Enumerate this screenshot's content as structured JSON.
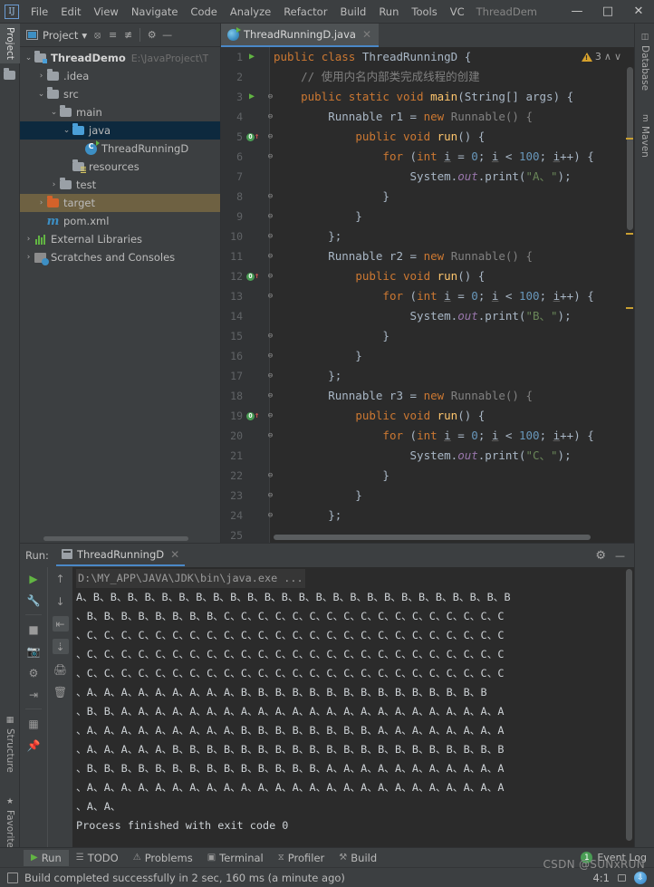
{
  "window": {
    "logo": "IJ",
    "project_name": "ThreadDem",
    "menus": [
      "File",
      "Edit",
      "View",
      "Navigate",
      "Code",
      "Analyze",
      "Refactor",
      "Build",
      "Run",
      "Tools",
      "VC"
    ],
    "minimize": "—",
    "maximize": "□",
    "close": "✕"
  },
  "left_strip": [
    {
      "label": "Project",
      "icon": "folder-icon",
      "active": true
    },
    {
      "label": "Structure",
      "icon": "structure-icon",
      "active": false
    },
    {
      "label": "Favorites",
      "icon": "star-icon",
      "active": false
    }
  ],
  "right_strip": [
    {
      "label": "Database",
      "icon": "database-icon"
    },
    {
      "label": "Maven",
      "icon": "maven-icon"
    }
  ],
  "project_panel": {
    "title": "Project",
    "dropdown_caret": "▾",
    "toolbar_icons": [
      "locate-icon",
      "expand-all-icon",
      "collapse-all-icon",
      "settings-gear-icon",
      "hide-icon"
    ],
    "tree": [
      {
        "label": "ThreadDemo",
        "path": "E:\\JavaProject\\T",
        "arrow": "⌄",
        "icon": "module-folder-icon",
        "indent": 0,
        "bold": true,
        "state": "normal"
      },
      {
        "label": ".idea",
        "path": "",
        "arrow": "›",
        "icon": "folder-icon",
        "indent": 1,
        "bold": false,
        "state": "normal"
      },
      {
        "label": "src",
        "path": "",
        "arrow": "⌄",
        "icon": "folder-icon",
        "indent": 1,
        "bold": false,
        "state": "normal"
      },
      {
        "label": "main",
        "path": "",
        "arrow": "⌄",
        "icon": "folder-icon",
        "indent": 2,
        "bold": false,
        "state": "normal"
      },
      {
        "label": "java",
        "path": "",
        "arrow": "⌄",
        "icon": "source-folder-icon",
        "indent": 3,
        "bold": false,
        "state": "selected"
      },
      {
        "label": "ThreadRunningD",
        "path": "",
        "arrow": "",
        "icon": "java-class-icon",
        "indent": 4,
        "bold": false,
        "state": "normal"
      },
      {
        "label": "resources",
        "path": "",
        "arrow": "",
        "icon": "resources-folder-icon",
        "indent": 3,
        "bold": false,
        "state": "normal"
      },
      {
        "label": "test",
        "path": "",
        "arrow": "›",
        "icon": "folder-icon",
        "indent": 2,
        "bold": false,
        "state": "normal"
      },
      {
        "label": "target",
        "path": "",
        "arrow": "›",
        "icon": "target-folder-icon",
        "indent": 1,
        "bold": false,
        "state": "highlighted"
      },
      {
        "label": "pom.xml",
        "path": "",
        "arrow": "",
        "icon": "maven-pom-icon",
        "indent": 1,
        "bold": false,
        "state": "normal"
      },
      {
        "label": "External Libraries",
        "path": "",
        "arrow": "›",
        "icon": "libraries-icon",
        "indent": 0,
        "bold": false,
        "state": "normal"
      },
      {
        "label": "Scratches and Consoles",
        "path": "",
        "arrow": "›",
        "icon": "scratches-icon",
        "indent": 0,
        "bold": false,
        "state": "normal"
      }
    ]
  },
  "editor": {
    "tab": {
      "label": "ThreadRunningD.java",
      "icon": "java-class-icon",
      "close": "✕"
    },
    "inspection": {
      "count": "3",
      "icon": "warning-triangle-icon",
      "up": "∧",
      "down": "∨"
    },
    "lines": [
      {
        "n": "1",
        "gutter": "run",
        "fold": "",
        "tokens": [
          {
            "t": "public ",
            "c": "kw"
          },
          {
            "t": "class ",
            "c": "kw"
          },
          {
            "t": "ThreadRunningD ",
            "c": "cls"
          },
          {
            "t": "{",
            "c": "plain"
          }
        ]
      },
      {
        "n": "2",
        "gutter": "",
        "fold": "",
        "tokens": [
          {
            "t": "    // 使用内名内部类完成线程的创建",
            "c": "cmt"
          }
        ]
      },
      {
        "n": "3",
        "gutter": "run",
        "fold": "v",
        "tokens": [
          {
            "t": "    ",
            "c": "plain"
          },
          {
            "t": "public static void ",
            "c": "kw"
          },
          {
            "t": "main",
            "c": "fn"
          },
          {
            "t": "(String[] args) {",
            "c": "plain"
          }
        ]
      },
      {
        "n": "4",
        "gutter": "",
        "fold": "v",
        "tokens": [
          {
            "t": "        Runnable r1 = ",
            "c": "plain"
          },
          {
            "t": "new ",
            "c": "kw"
          },
          {
            "t": "Runnable() {",
            "c": "gray"
          }
        ]
      },
      {
        "n": "5",
        "gutter": "ovr",
        "fold": "v",
        "tokens": [
          {
            "t": "            ",
            "c": "plain"
          },
          {
            "t": "public void ",
            "c": "kw"
          },
          {
            "t": "run",
            "c": "fn"
          },
          {
            "t": "() {",
            "c": "plain"
          }
        ]
      },
      {
        "n": "6",
        "gutter": "",
        "fold": "v",
        "tokens": [
          {
            "t": "                ",
            "c": "plain"
          },
          {
            "t": "for ",
            "c": "kw"
          },
          {
            "t": "(",
            "c": "plain"
          },
          {
            "t": "int ",
            "c": "kw"
          },
          {
            "t": "i",
            "c": "vr"
          },
          {
            "t": " = ",
            "c": "plain"
          },
          {
            "t": "0",
            "c": "num"
          },
          {
            "t": "; ",
            "c": "plain"
          },
          {
            "t": "i",
            "c": "vr"
          },
          {
            "t": " < ",
            "c": "plain"
          },
          {
            "t": "100",
            "c": "num"
          },
          {
            "t": "; ",
            "c": "plain"
          },
          {
            "t": "i",
            "c": "vr"
          },
          {
            "t": "++) {",
            "c": "plain"
          }
        ]
      },
      {
        "n": "7",
        "gutter": "",
        "fold": "",
        "tokens": [
          {
            "t": "                    System.",
            "c": "plain"
          },
          {
            "t": "out",
            "c": "fld"
          },
          {
            "t": ".print(",
            "c": "plain"
          },
          {
            "t": "\"A、\"",
            "c": "str"
          },
          {
            "t": ");",
            "c": "plain"
          }
        ]
      },
      {
        "n": "8",
        "gutter": "",
        "fold": "^",
        "tokens": [
          {
            "t": "                }",
            "c": "plain"
          }
        ]
      },
      {
        "n": "9",
        "gutter": "",
        "fold": "^",
        "tokens": [
          {
            "t": "            }",
            "c": "plain"
          }
        ]
      },
      {
        "n": "10",
        "gutter": "",
        "fold": "^",
        "tokens": [
          {
            "t": "        };",
            "c": "plain"
          }
        ]
      },
      {
        "n": "11",
        "gutter": "",
        "fold": "v",
        "tokens": [
          {
            "t": "        Runnable r2 = ",
            "c": "plain"
          },
          {
            "t": "new ",
            "c": "kw"
          },
          {
            "t": "Runnable() {",
            "c": "gray"
          }
        ]
      },
      {
        "n": "12",
        "gutter": "ovr",
        "fold": "v",
        "tokens": [
          {
            "t": "            ",
            "c": "plain"
          },
          {
            "t": "public void ",
            "c": "kw"
          },
          {
            "t": "run",
            "c": "fn"
          },
          {
            "t": "() {",
            "c": "plain"
          }
        ]
      },
      {
        "n": "13",
        "gutter": "",
        "fold": "v",
        "tokens": [
          {
            "t": "                ",
            "c": "plain"
          },
          {
            "t": "for ",
            "c": "kw"
          },
          {
            "t": "(",
            "c": "plain"
          },
          {
            "t": "int ",
            "c": "kw"
          },
          {
            "t": "i",
            "c": "vr"
          },
          {
            "t": " = ",
            "c": "plain"
          },
          {
            "t": "0",
            "c": "num"
          },
          {
            "t": "; ",
            "c": "plain"
          },
          {
            "t": "i",
            "c": "vr"
          },
          {
            "t": " < ",
            "c": "plain"
          },
          {
            "t": "100",
            "c": "num"
          },
          {
            "t": "; ",
            "c": "plain"
          },
          {
            "t": "i",
            "c": "vr"
          },
          {
            "t": "++) {",
            "c": "plain"
          }
        ]
      },
      {
        "n": "14",
        "gutter": "",
        "fold": "",
        "tokens": [
          {
            "t": "                    System.",
            "c": "plain"
          },
          {
            "t": "out",
            "c": "fld"
          },
          {
            "t": ".print(",
            "c": "plain"
          },
          {
            "t": "\"B、\"",
            "c": "str"
          },
          {
            "t": ");",
            "c": "plain"
          }
        ]
      },
      {
        "n": "15",
        "gutter": "",
        "fold": "^",
        "tokens": [
          {
            "t": "                }",
            "c": "plain"
          }
        ]
      },
      {
        "n": "16",
        "gutter": "",
        "fold": "^",
        "tokens": [
          {
            "t": "            }",
            "c": "plain"
          }
        ]
      },
      {
        "n": "17",
        "gutter": "",
        "fold": "^",
        "tokens": [
          {
            "t": "        };",
            "c": "plain"
          }
        ]
      },
      {
        "n": "18",
        "gutter": "",
        "fold": "v",
        "tokens": [
          {
            "t": "        Runnable r3 = ",
            "c": "plain"
          },
          {
            "t": "new ",
            "c": "kw"
          },
          {
            "t": "Runnable() {",
            "c": "gray"
          }
        ]
      },
      {
        "n": "19",
        "gutter": "ovr",
        "fold": "v",
        "tokens": [
          {
            "t": "            ",
            "c": "plain"
          },
          {
            "t": "public void ",
            "c": "kw"
          },
          {
            "t": "run",
            "c": "fn"
          },
          {
            "t": "() {",
            "c": "plain"
          }
        ]
      },
      {
        "n": "20",
        "gutter": "",
        "fold": "v",
        "tokens": [
          {
            "t": "                ",
            "c": "plain"
          },
          {
            "t": "for ",
            "c": "kw"
          },
          {
            "t": "(",
            "c": "plain"
          },
          {
            "t": "int ",
            "c": "kw"
          },
          {
            "t": "i",
            "c": "vr"
          },
          {
            "t": " = ",
            "c": "plain"
          },
          {
            "t": "0",
            "c": "num"
          },
          {
            "t": "; ",
            "c": "plain"
          },
          {
            "t": "i",
            "c": "vr"
          },
          {
            "t": " < ",
            "c": "plain"
          },
          {
            "t": "100",
            "c": "num"
          },
          {
            "t": "; ",
            "c": "plain"
          },
          {
            "t": "i",
            "c": "vr"
          },
          {
            "t": "++) {",
            "c": "plain"
          }
        ]
      },
      {
        "n": "21",
        "gutter": "",
        "fold": "",
        "tokens": [
          {
            "t": "                    System.",
            "c": "plain"
          },
          {
            "t": "out",
            "c": "fld"
          },
          {
            "t": ".print(",
            "c": "plain"
          },
          {
            "t": "\"C、\"",
            "c": "str"
          },
          {
            "t": ");",
            "c": "plain"
          }
        ]
      },
      {
        "n": "22",
        "gutter": "",
        "fold": "^",
        "tokens": [
          {
            "t": "                }",
            "c": "plain"
          }
        ]
      },
      {
        "n": "23",
        "gutter": "",
        "fold": "^",
        "tokens": [
          {
            "t": "            }",
            "c": "plain"
          }
        ]
      },
      {
        "n": "24",
        "gutter": "",
        "fold": "^",
        "tokens": [
          {
            "t": "        };",
            "c": "plain"
          }
        ]
      },
      {
        "n": "25",
        "gutter": "",
        "fold": "",
        "tokens": [
          {
            "t": "",
            "c": "plain"
          }
        ]
      }
    ]
  },
  "run_panel": {
    "label": "Run:",
    "tab": "ThreadRunningD",
    "tab_close": "✕",
    "settings_icon": "gear-icon",
    "hide_icon": "—",
    "left_tools": [
      "rerun-icon",
      "wrench-icon",
      "stop-icon",
      "camera-icon",
      "thread-dump-icon",
      "export-icon",
      "layout-icon",
      "pin-icon"
    ],
    "right_tools": [
      "up-arrow-icon",
      "down-arrow-icon",
      "soft-wrap-icon",
      "scroll-to-end-icon",
      "print-icon",
      "trash-icon"
    ],
    "console": {
      "command": "D:\\MY_APP\\JAVA\\JDK\\bin\\java.exe ...",
      "lines": [
        "A、B、B、B、B、B、B、B、B、B、B、B、B、B、B、B、B、B、B、B、B、B、B、B、B、B",
        "、B、B、B、B、B、B、B、B、C、C、C、C、C、C、C、C、C、C、C、C、C、C、C、C、C",
        "、C、C、C、C、C、C、C、C、C、C、C、C、C、C、C、C、C、C、C、C、C、C、C、C、C",
        "、C、C、C、C、C、C、C、C、C、C、C、C、C、C、C、C、C、C、C、C、C、C、C、C、C",
        "、C、C、C、C、C、C、C、C、C、C、C、C、C、C、C、C、C、C、C、C、C、C、C、C、C",
        "、A、A、A、A、A、A、A、A、A、B、B、B、B、B、B、B、B、B、B、B、B、B、B、B",
        "、B、B、A、A、A、A、A、A、A、A、A、A、A、A、A、A、A、A、A、A、A、A、A、A、A",
        "、A、A、A、A、A、A、A、A、A、B、B、B、B、B、B、B、B、A、A、A、A、A、A、A、A",
        "、A、A、A、A、A、B、B、B、B、B、B、B、B、B、B、B、B、B、B、B、B、B、B、B、B",
        "、B、B、B、B、B、B、B、B、B、B、B、B、B、B、A、A、A、A、A、A、A、A、A、A、A",
        "、A、A、A、A、A、A、A、A、A、A、A、A、A、A、A、A、A、A、A、A、A、A、A、A、A",
        "、A、A、"
      ],
      "exit_message": "Process finished with exit code 0"
    }
  },
  "bottom_bar": {
    "items": [
      {
        "label": "Run",
        "icon": "run-triangle-icon",
        "active": true
      },
      {
        "label": "TODO",
        "icon": "todo-list-icon",
        "active": false
      },
      {
        "label": "Problems",
        "icon": "problems-icon",
        "active": false
      },
      {
        "label": "Terminal",
        "icon": "terminal-icon",
        "active": false
      },
      {
        "label": "Profiler",
        "icon": "profiler-icon",
        "active": false
      },
      {
        "label": "Build",
        "icon": "build-hammer-icon",
        "active": false
      }
    ],
    "event_log": {
      "label": "Event Log",
      "count": "1"
    }
  },
  "status_bar": {
    "message": "Build completed successfully in 2 sec, 160 ms (a minute ago)",
    "caret_position": "4:1",
    "icons": [
      "message-icon",
      "lock-icon",
      "notifications-icon"
    ]
  },
  "watermark": "CSDN @SUNxRUN",
  "colors": {
    "chrome_bg": "#3c3f41",
    "editor_bg": "#2b2b2b",
    "gutter_bg": "#313335",
    "accent_blue": "#4a88c7",
    "selection_blue": "#0d293e",
    "highlight_tan": "#6e6142",
    "keyword_orange": "#cc7832",
    "string_green": "#6a8759",
    "number_blue": "#6897bb",
    "method_yellow": "#ffc66d",
    "field_purple": "#9876aa",
    "comment_gray": "#808080",
    "warning_yellow": "#d6a12c",
    "run_green": "#62b543"
  }
}
